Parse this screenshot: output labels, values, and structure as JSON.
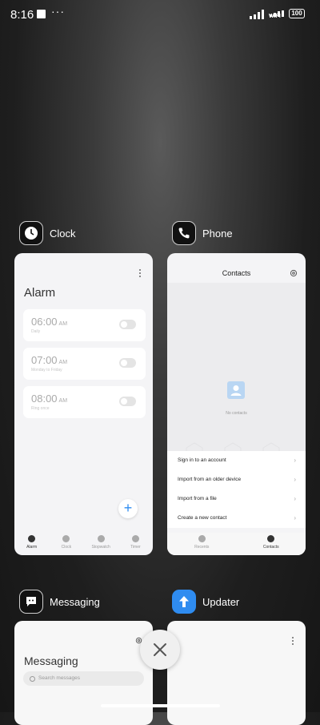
{
  "status_bar": {
    "time": "8:16",
    "dots": "···",
    "wifi_label": "WIFI",
    "battery": "100"
  },
  "apps": {
    "clock": {
      "label": "Clock",
      "icon": "clock-icon"
    },
    "phone": {
      "label": "Phone",
      "icon": "phone-icon"
    },
    "messaging": {
      "label": "Messaging",
      "icon": "message-icon"
    },
    "updater": {
      "label": "Updater",
      "icon": "arrow-up-icon",
      "color": "#2f8cf0"
    }
  },
  "clock_card": {
    "title": "Alarm",
    "alarms": [
      {
        "time": "06:00",
        "ampm": "AM",
        "sub": "Daily"
      },
      {
        "time": "07:00",
        "ampm": "AM",
        "sub": "Monday to Friday"
      },
      {
        "time": "08:00",
        "ampm": "AM",
        "sub": "Ring once"
      }
    ],
    "nav": [
      {
        "label": "Alarm",
        "active": true
      },
      {
        "label": "Clock"
      },
      {
        "label": "Stopwatch"
      },
      {
        "label": "Timer"
      }
    ]
  },
  "phone_card": {
    "title": "Contacts",
    "empty_text": "No contacts",
    "menu": [
      "Sign in to an account",
      "Import from an older device",
      "Import from a file",
      "Create a new contact"
    ],
    "nav": [
      {
        "label": "Recents"
      },
      {
        "label": "Contacts",
        "active": true
      }
    ]
  },
  "messaging_card": {
    "title": "Messaging",
    "search_placeholder": "Search messages"
  },
  "accent_color": "#2f8cf0"
}
